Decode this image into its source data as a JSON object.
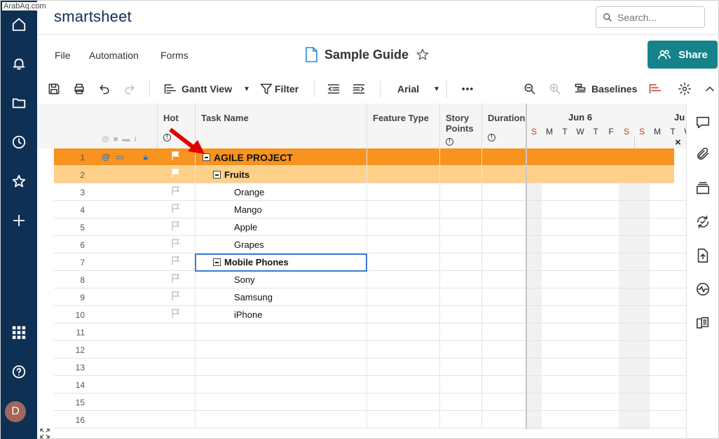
{
  "watermark": "ArabAq.com",
  "app": {
    "logo": "smartsheet"
  },
  "search": {
    "placeholder": "Search..."
  },
  "menu": {
    "file": "File",
    "automation": "Automation",
    "forms": "Forms"
  },
  "sheet": {
    "title": "Sample Guide"
  },
  "share": {
    "label": "Share"
  },
  "toolbar": {
    "view": "Gantt View",
    "filter": "Filter",
    "font": "Arial",
    "baselines": "Baselines"
  },
  "columns": {
    "hot": "Hot",
    "task": "Task Name",
    "feature": "Feature Type",
    "story": "Story Points",
    "duration": "Duration"
  },
  "gantt": {
    "week1": "Jun 6",
    "week2": "Ju",
    "days": [
      "S",
      "M",
      "T",
      "W",
      "T",
      "F",
      "S",
      "S",
      "M",
      "T",
      "W"
    ],
    "close": "×"
  },
  "rows": [
    {
      "n": "1",
      "task": "AGILE PROJECT",
      "level": 0
    },
    {
      "n": "2",
      "task": "Fruits",
      "level": 1
    },
    {
      "n": "3",
      "task": "Orange",
      "level": 2
    },
    {
      "n": "4",
      "task": "Mango",
      "level": 2
    },
    {
      "n": "5",
      "task": "Apple",
      "level": 2
    },
    {
      "n": "6",
      "task": "Grapes",
      "level": 2
    },
    {
      "n": "7",
      "task": "Mobile Phones",
      "level": 1
    },
    {
      "n": "8",
      "task": "Sony",
      "level": 2
    },
    {
      "n": "9",
      "task": "Samsung",
      "level": 2
    },
    {
      "n": "10",
      "task": "iPhone",
      "level": 2
    },
    {
      "n": "11",
      "task": "",
      "level": 2
    },
    {
      "n": "12",
      "task": "",
      "level": 2
    },
    {
      "n": "13",
      "task": "",
      "level": 2
    },
    {
      "n": "14",
      "task": "",
      "level": 2
    },
    {
      "n": "15",
      "task": "",
      "level": 2
    },
    {
      "n": "16",
      "task": "",
      "level": 2
    }
  ],
  "user": {
    "initial": "D"
  },
  "colors": {
    "rail": "#0f3055",
    "accent": "#16838b",
    "parentRow": "#f7931e",
    "childRow": "#ffd08a"
  }
}
